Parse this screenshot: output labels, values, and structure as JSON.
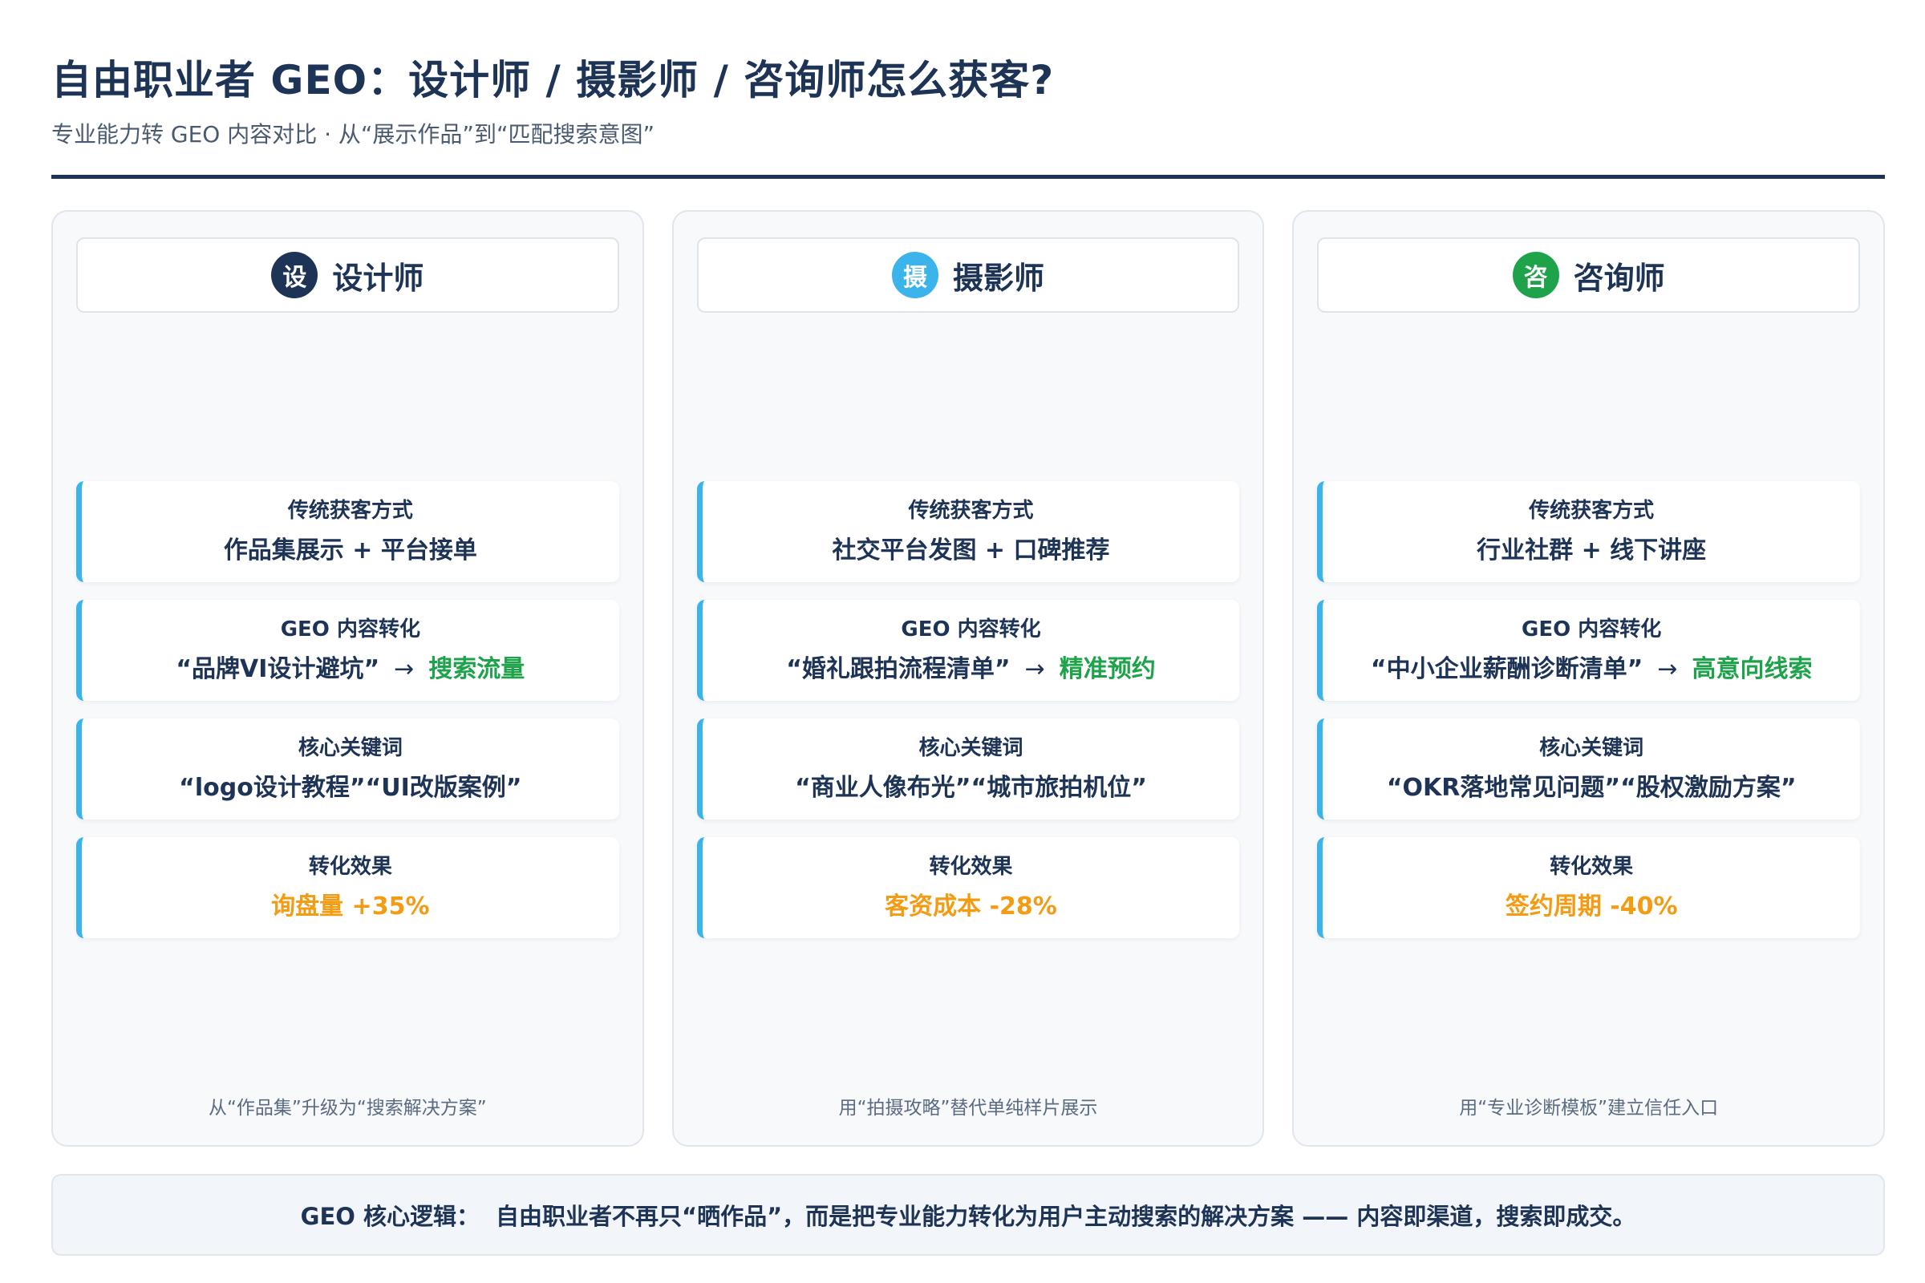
{
  "header": {
    "title": "自由职业者 GEO：设计师 / 摄影师 / 咨询师怎么获客?",
    "subtitle": "专业能力转 GEO 内容对比 · 从“展示作品”到“匹配搜索意图”"
  },
  "labels": {
    "traditional": "传统获客方式",
    "geo": "GEO 内容转化",
    "keywords": "核心关键词",
    "effect": "转化效果",
    "arrow": "→"
  },
  "columns": [
    {
      "badge": "设",
      "badge_color": "#1e3456",
      "title": "设计师",
      "traditional": "作品集展示 + 平台接单",
      "geo_content": "“品牌VI设计避坑”",
      "geo_result": "搜索流量",
      "keywords": "“logo设计教程”“UI改版案例”",
      "effect": "询盘量 +35%",
      "footer": "从“作品集”升级为“搜索解决方案”"
    },
    {
      "badge": "摄",
      "badge_color": "#3ab4ea",
      "title": "摄影师",
      "traditional": "社交平台发图 + 口碑推荐",
      "geo_content": "“婚礼跟拍流程清单”",
      "geo_result": "精准预约",
      "keywords": "“商业人像布光”“城市旅拍机位”",
      "effect": "客资成本 -28%",
      "footer": "用“拍摄攻略”替代单纯样片展示"
    },
    {
      "badge": "咨",
      "badge_color": "#1ea34b",
      "title": "咨询师",
      "traditional": "行业社群 + 线下讲座",
      "geo_content": "“中小企业薪酬诊断清单”",
      "geo_result": "高意向线索",
      "keywords": "“OKR落地常见问题”“股权激励方案”",
      "effect": "签约周期 -40%",
      "footer": "用“专业诊断模板”建立信任入口"
    }
  ],
  "summary": {
    "lead": "GEO 核心逻辑：",
    "text": "自由职业者不再只“晒作品”，而是把专业能力转化为用户主动搜索的解决方案 —— 内容即渠道，搜索即成交。"
  }
}
